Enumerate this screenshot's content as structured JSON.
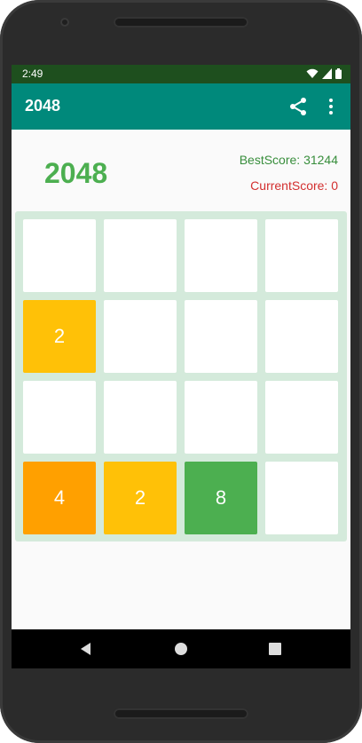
{
  "status_bar": {
    "time": "2:49"
  },
  "app_bar": {
    "title": "2048"
  },
  "game": {
    "title": "2048",
    "best_score": "BestScore: 31244",
    "current_score": "CurrentScore: 0",
    "tiles": [
      [
        "",
        "",
        "",
        ""
      ],
      [
        "2",
        "",
        "",
        ""
      ],
      [
        "",
        "",
        "",
        ""
      ],
      [
        "4",
        "2",
        "8",
        ""
      ]
    ],
    "tile_colors": {
      "empty": "#ffffff",
      "2": "#ffc107",
      "4": "#ffa000",
      "8": "#4caf50"
    }
  },
  "icons": {
    "share": "share-icon",
    "menu": "more-vert-icon",
    "back": "back-icon",
    "home": "home-icon",
    "recents": "recents-icon"
  },
  "colors": {
    "status_bar": "#1e4f1e",
    "app_bar": "#00897b",
    "board": "#d4eadb",
    "title": "#4caf50",
    "best_score": "#388e3c",
    "current_score": "#d32f2f"
  }
}
